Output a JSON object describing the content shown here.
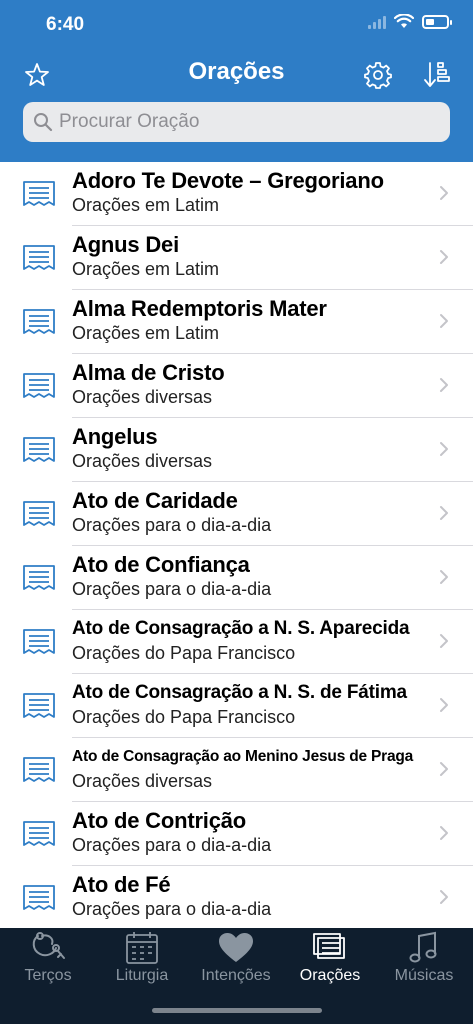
{
  "status": {
    "time": "6:40"
  },
  "nav": {
    "title": "Orações",
    "favorites_icon": "star-icon",
    "settings_icon": "gear-icon",
    "sort_icon": "sort-icon"
  },
  "search": {
    "placeholder": "Procurar Oração",
    "value": ""
  },
  "colors": {
    "header": "#2e7dc6",
    "tabbar": "#0f1e2e",
    "icon_blue": "#2e7dc6",
    "chevron": "#c4c4c9"
  },
  "prayers": [
    {
      "title": "Adoro Te Devote – Gregoriano",
      "category": "Orações em Latim"
    },
    {
      "title": "Agnus Dei",
      "category": "Orações em Latim"
    },
    {
      "title": "Alma Redemptoris Mater",
      "category": "Orações em Latim"
    },
    {
      "title": "Alma de Cristo",
      "category": "Orações diversas"
    },
    {
      "title": "Angelus",
      "category": "Orações diversas"
    },
    {
      "title": "Ato de Caridade",
      "category": "Orações para o dia-a-dia"
    },
    {
      "title": "Ato de Confiança",
      "category": "Orações para o dia-a-dia"
    },
    {
      "title": "Ato de Consagração a N. S. Aparecida",
      "category": "Orações do Papa Francisco"
    },
    {
      "title": "Ato de Consagração a N. S. de Fátima",
      "category": "Orações do Papa Francisco"
    },
    {
      "title": "Ato de Consagração ao Menino Jesus de Praga",
      "category": "Orações diversas"
    },
    {
      "title": "Ato de Contrição",
      "category": "Orações para o dia-a-dia"
    },
    {
      "title": "Ato de Fé",
      "category": "Orações para o dia-a-dia"
    }
  ],
  "tabs": [
    {
      "label": "Terços",
      "icon": "rosary-icon",
      "active": false
    },
    {
      "label": "Liturgia",
      "icon": "calendar-icon",
      "active": false
    },
    {
      "label": "Intenções",
      "icon": "heart-icon",
      "active": false
    },
    {
      "label": "Orações",
      "icon": "prayer-cards-icon",
      "active": true
    },
    {
      "label": "Músicas",
      "icon": "music-note-icon",
      "active": false
    }
  ]
}
